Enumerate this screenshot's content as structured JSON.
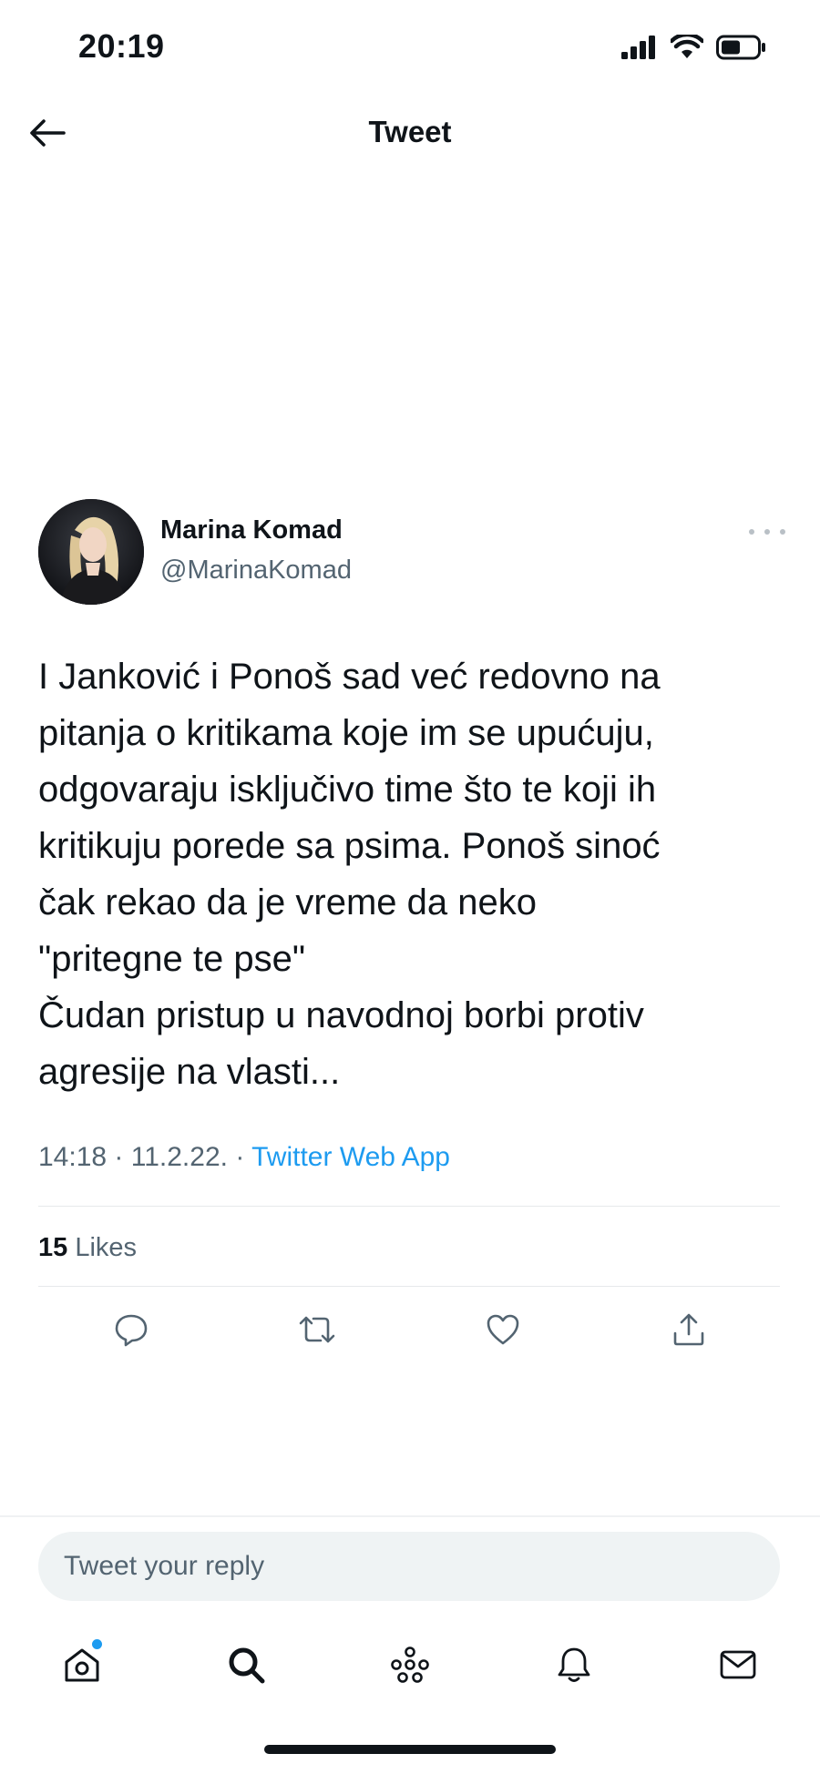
{
  "status_bar": {
    "time": "20:19",
    "signal_icon": "cellular-signal-icon",
    "wifi_icon": "wifi-icon",
    "battery_icon": "battery-icon"
  },
  "header": {
    "title": "Tweet",
    "back_icon": "arrow-left-icon"
  },
  "tweet": {
    "author_name": "Marina Komad",
    "author_handle": "@MarinaKomad",
    "text": "I Janković i Ponoš sad već redovno na\npitanja o kritikama koje im se upućuju,\nodgovaraju isključivo time što te koji ih\nkritikuju porede sa psima. Ponoš sinoć\nčak rekao da je vreme da neko\n\"pritegne te pse\"\nČudan pristup u navodnoj borbi protiv\nagresije na vlasti...",
    "time": "14:18",
    "date": "11.2.22.",
    "separator": "·",
    "source": "Twitter Web App",
    "likes_count": "15",
    "likes_label": "Likes"
  },
  "actions": {
    "reply_icon": "reply-icon",
    "retweet_icon": "retweet-icon",
    "like_icon": "heart-icon",
    "share_icon": "share-icon"
  },
  "reply": {
    "placeholder": "Tweet your reply"
  },
  "tabbar": {
    "items": [
      "home-icon",
      "search-icon",
      "spaces-icon",
      "notifications-icon",
      "messages-icon"
    ]
  },
  "colors": {
    "accent": "#1d9bf0",
    "text": "#0f1419",
    "muted": "#536471"
  }
}
